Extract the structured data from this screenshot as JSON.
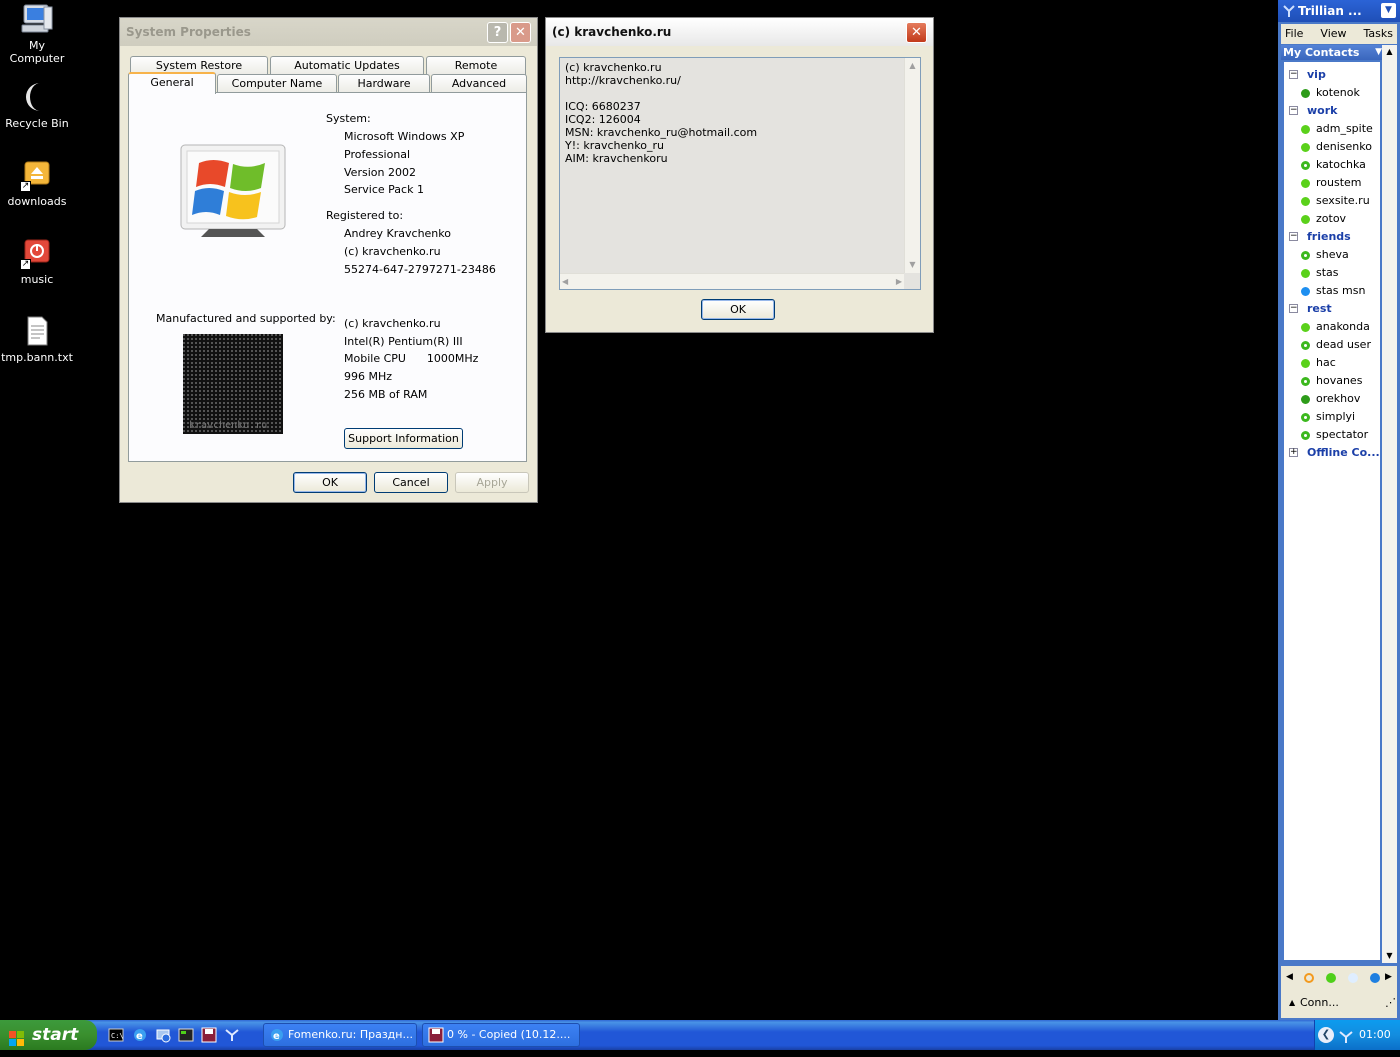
{
  "desktop_icons": [
    {
      "label": "My Computer",
      "icon": "my-computer-icon"
    },
    {
      "label": "Recycle Bin",
      "icon": "recycle-bin-icon"
    },
    {
      "label": "downloads",
      "icon": "folder-shortcut-icon"
    },
    {
      "label": "music",
      "icon": "music-shortcut-icon"
    },
    {
      "label": "tmp.bann.txt",
      "icon": "text-file-icon"
    }
  ],
  "sysprops": {
    "title": "System Properties",
    "tabs_row1": [
      "System Restore",
      "Automatic Updates",
      "Remote"
    ],
    "tabs_row2": [
      "General",
      "Computer Name",
      "Hardware",
      "Advanced"
    ],
    "system_label": "System:",
    "system_lines": [
      "Microsoft Windows XP",
      "Professional",
      "Version 2002",
      "Service Pack 1"
    ],
    "registered_label": "Registered to:",
    "registered_lines": [
      "Andrey Kravchenko",
      "(c) kravchenko.ru",
      "55274-647-2797271-23486"
    ],
    "manufactured_label": "Manufactured and supported by:",
    "oem_logo_text": "kravchenko.ru",
    "manufacturer_lines": [
      "(c) kravchenko.ru",
      "Intel(R) Pentium(R) III",
      "Mobile CPU      1000MHz",
      "996 MHz",
      "256 MB of RAM"
    ],
    "support_button": "Support Information",
    "ok": "OK",
    "cancel": "Cancel",
    "apply": "Apply"
  },
  "info_dialog": {
    "title": "(c) kravchenko.ru",
    "lines": [
      "(c) kravchenko.ru",
      "http://kravchenko.ru/",
      "",
      "ICQ: 6680237",
      "ICQ2: 126004",
      "MSN: kravchenko_ru@hotmail.com",
      "Y!: kravchenko_ru",
      "AIM: kravchenkoru"
    ],
    "ok": "OK"
  },
  "trillian": {
    "title": "Trillian ...",
    "menu": [
      "File",
      "View",
      "Tasks"
    ],
    "header": "My Contacts",
    "groups": [
      {
        "name": "vip",
        "expanded": true,
        "contacts": [
          {
            "name": "kotenok",
            "status": "away"
          }
        ]
      },
      {
        "name": "work",
        "expanded": true,
        "contacts": [
          {
            "name": "adm_spite",
            "status": "online"
          },
          {
            "name": "denisenko",
            "status": "online"
          },
          {
            "name": "katochka",
            "status": "busy"
          },
          {
            "name": "roustem",
            "status": "online"
          },
          {
            "name": "sexsite.ru",
            "status": "online"
          },
          {
            "name": "zotov",
            "status": "online"
          }
        ]
      },
      {
        "name": "friends",
        "expanded": true,
        "contacts": [
          {
            "name": "sheva",
            "status": "busy"
          },
          {
            "name": "stas",
            "status": "online"
          },
          {
            "name": "stas msn",
            "status": "msn"
          }
        ]
      },
      {
        "name": "rest",
        "expanded": true,
        "contacts": [
          {
            "name": "anakonda",
            "status": "online"
          },
          {
            "name": "dead user",
            "status": "busy"
          },
          {
            "name": "hac",
            "status": "online"
          },
          {
            "name": "hovanes",
            "status": "busy"
          },
          {
            "name": "orekhov",
            "status": "away"
          },
          {
            "name": "simplyi",
            "status": "busy"
          },
          {
            "name": "spectator",
            "status": "busy"
          }
        ]
      },
      {
        "name": "Offline Co...",
        "expanded": false,
        "contacts": []
      }
    ],
    "connect_label": "Conn...",
    "status_colors": {
      "online": "#5bd11b",
      "busy": "#3cb81e",
      "away": "#2e9c1a",
      "msn": "#1e8ff0"
    }
  },
  "taskbar": {
    "start": "start",
    "tasks": [
      {
        "label": "Fomenko.ru: Праздн...",
        "icon": "ie-icon"
      },
      {
        "label": "0 % - Copied (10.12....",
        "icon": "floppy-copy-icon"
      }
    ],
    "clock": "01:00"
  }
}
